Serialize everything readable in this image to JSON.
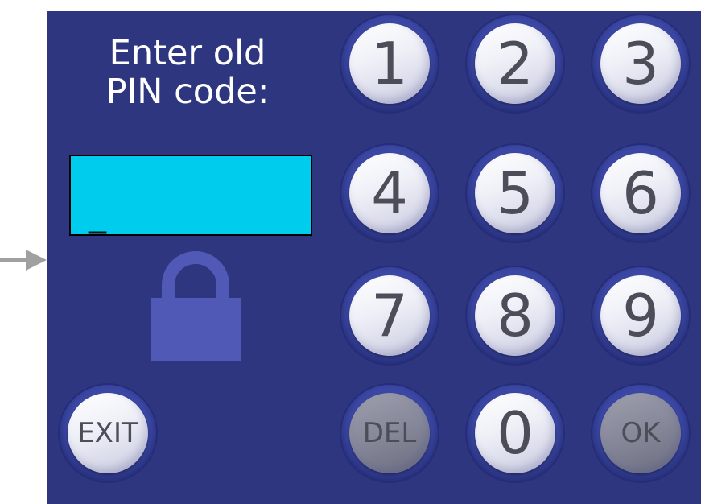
{
  "prompt": {
    "line1": "Enter old",
    "line2": "PIN code:"
  },
  "pin_field": {
    "value": "_"
  },
  "keypad": {
    "keys": [
      "1",
      "2",
      "3",
      "4",
      "5",
      "6",
      "7",
      "8",
      "9"
    ],
    "del_label": "DEL",
    "zero_label": "0",
    "ok_label": "OK"
  },
  "exit_label": "EXIT",
  "colors": {
    "panel": "#2e3680",
    "pin_field": "#00ccee",
    "lock": "#5059b5",
    "arrow": "#a0a0a0"
  },
  "icons": {
    "pointer": "arrow-right-icon",
    "lock": "padlock-icon"
  }
}
